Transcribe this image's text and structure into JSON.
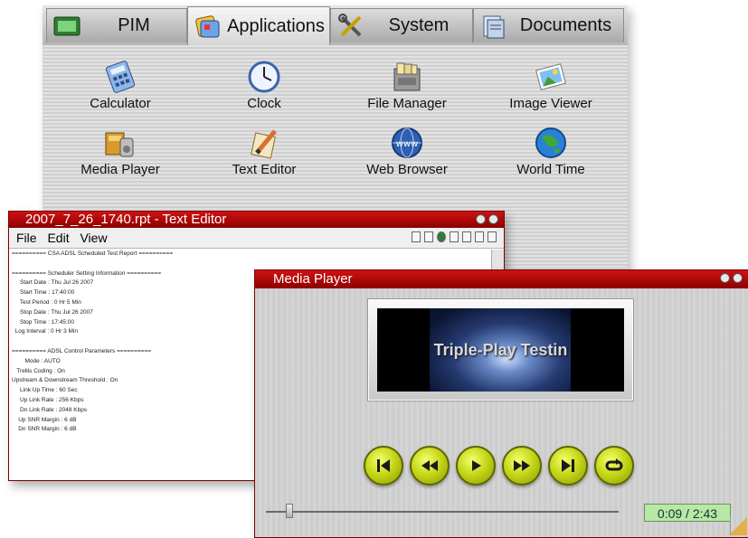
{
  "launcher": {
    "tabs": [
      {
        "label": "PIM",
        "icon": "pim-icon"
      },
      {
        "label": "Applications",
        "icon": "applications-icon"
      },
      {
        "label": "System",
        "icon": "system-tools-icon"
      },
      {
        "label": "Documents",
        "icon": "documents-icon"
      }
    ],
    "active_tab": "Applications",
    "apps": [
      {
        "label": "Calculator",
        "icon": "calculator-icon"
      },
      {
        "label": "Clock",
        "icon": "clock-icon"
      },
      {
        "label": "File Manager",
        "icon": "file-manager-icon"
      },
      {
        "label": "Image Viewer",
        "icon": "image-viewer-icon"
      },
      {
        "label": "Media Player",
        "icon": "media-player-icon"
      },
      {
        "label": "Text Editor",
        "icon": "text-editor-icon"
      },
      {
        "label": "Web Browser",
        "icon": "web-browser-icon"
      },
      {
        "label": "World Time",
        "icon": "world-time-icon"
      }
    ]
  },
  "editor": {
    "title": "2007_7_26_1740.rpt - Text Editor",
    "menu": [
      "File",
      "Edit",
      "View"
    ],
    "lines": [
      "========== CSA ADSL Scheduled Test Report ==========",
      "",
      "========== Scheduler Setting Information ==========",
      "     Start Date : Thu Jul 26 2007",
      "     Start Time : 17:40:00",
      "     Test Period : 0 Hr 5 Min",
      "     Stop Date : Thu Jul 26 2007",
      "     Stop Time : 17:45:00",
      "  Log Interval : 0 Hr 3 Min",
      "",
      "========== ADSL Control Parameters ==========",
      "        Mode : AUTO",
      "   Trellis Coding : On",
      "Upstream & Downstream Threshold : On",
      "     Link Up Time : 60 Sec",
      "     Up Link Rate : 256 Kbps",
      "     Dn Link Rate : 2048 Kbps",
      "    Up SNR Margin : 6 dB",
      "    Dn SNR Margin : 6 dB"
    ]
  },
  "player": {
    "title": "Media Player",
    "video_caption": "Triple-Play Testin",
    "controls": [
      "skip-to-start",
      "rewind",
      "play",
      "fast-forward",
      "skip-to-end",
      "repeat"
    ],
    "time": "0:09 / 2:43",
    "progress": 0.055
  },
  "colors": {
    "titlebar_red": "#b00000",
    "control_yellow_green": "#c7d81a",
    "time_display": "#b7e8a5"
  }
}
